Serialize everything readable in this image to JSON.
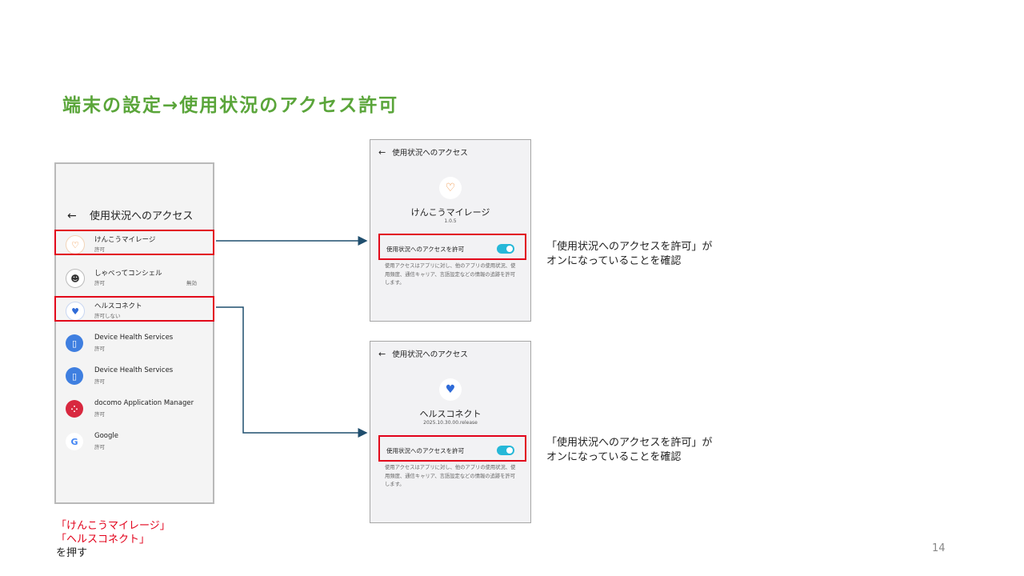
{
  "title": "端末の設定→使用状況のアクセス許可",
  "list_screen": {
    "back_icon": "←",
    "header": "使用状況へのアクセス",
    "items": [
      {
        "name": "けんこうマイレージ",
        "status": "許可",
        "extra": "",
        "icon": "kenko-mileage-icon",
        "glyph": "♡"
      },
      {
        "name": "しゃべってコンシェル",
        "status": "許可",
        "extra": "無効",
        "icon": "shabette-concier-icon",
        "glyph": "☻"
      },
      {
        "name": "ヘルスコネクト",
        "status": "許可しない",
        "extra": "",
        "icon": "health-connect-icon",
        "glyph": "♥"
      },
      {
        "name": "Device Health Services",
        "status": "許可",
        "extra": "",
        "icon": "device-health-icon",
        "glyph": "▯"
      },
      {
        "name": "Device Health Services",
        "status": "許可",
        "extra": "",
        "icon": "device-health-icon",
        "glyph": "▯"
      },
      {
        "name": "docomo Application Manager",
        "status": "許可",
        "extra": "",
        "icon": "docomo-app-manager-icon",
        "glyph": "⁘"
      },
      {
        "name": "Google",
        "status": "許可",
        "extra": "",
        "icon": "google-icon",
        "glyph": "G"
      }
    ]
  },
  "detail_kenko": {
    "back_icon": "←",
    "header": "使用状況へのアクセス",
    "app_name": "けんこうマイレージ",
    "version": "1.0.5",
    "toggle_label": "使用状況へのアクセスを許可",
    "toggle_on": true,
    "description": "使用アクセスはアプリに対し、他のアプリの使用状況、使用頻度、通信キャリア、言語設定などの情報の追跡を許可します。"
  },
  "detail_health": {
    "back_icon": "←",
    "header": "使用状況へのアクセス",
    "app_name": "ヘルスコネクト",
    "version": "2025.10.30.00.release",
    "toggle_label": "使用状況へのアクセスを許可",
    "toggle_on": true,
    "description": "使用アクセスはアプリに対し、他のアプリの使用状況、使用頻度、通信キャリア、言語設定などの情報の追跡を許可します。"
  },
  "note_top": {
    "line1": "「使用状況へのアクセスを許可」が",
    "line2": "オンになっていることを確認"
  },
  "note_bottom": {
    "line1": "「使用状況へのアクセスを許可」が",
    "line2": "オンになっていることを確認"
  },
  "instruction": {
    "line1": "「けんこうマイレージ」",
    "line2": "「ヘルスコネクト」",
    "line3": "を押す"
  },
  "page_number": "14",
  "colors": {
    "title": "#5aa53a",
    "highlight": "#e2001a",
    "connector": "#1f4e6e",
    "toggle": "#26b8d8"
  }
}
